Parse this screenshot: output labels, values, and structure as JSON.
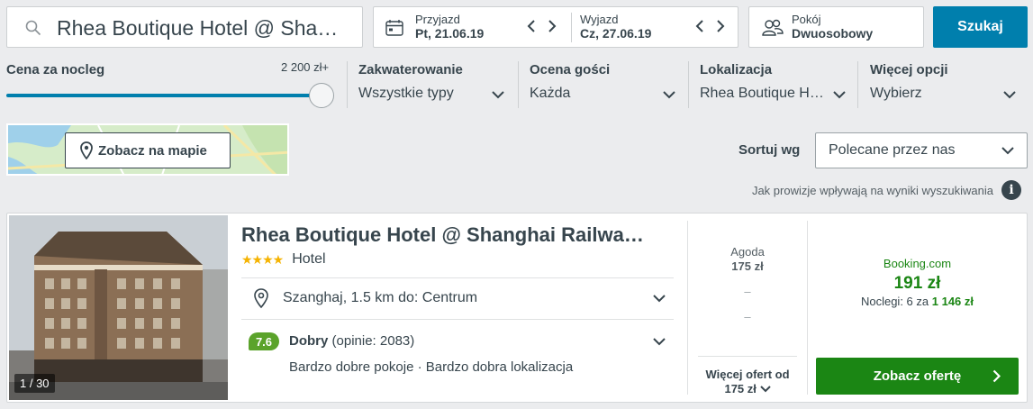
{
  "search": {
    "value": "Rhea Boutique Hotel @ Sha…"
  },
  "dates": {
    "checkin_label": "Przyjazd",
    "checkin_value": "Pt, 21.06.19",
    "checkout_label": "Wyjazd",
    "checkout_value": "Cz, 27.06.19"
  },
  "room": {
    "label": "Pokój",
    "value": "Dwuosobowy"
  },
  "search_button": "Szukaj",
  "filters": {
    "price": {
      "label": "Cena za nocleg",
      "max": "2 200 zł+",
      "slider_fraction": 1.0
    },
    "accommodation": {
      "label": "Zakwaterowanie",
      "value": "Wszystkie typy"
    },
    "rating": {
      "label": "Ocena gości",
      "value": "Każda"
    },
    "location": {
      "label": "Lokalizacja",
      "value": "Rhea Boutique H…"
    },
    "more": {
      "label": "Więcej opcji",
      "value": "Wybierz"
    }
  },
  "map_button": "Zobacz na mapie",
  "sort": {
    "label": "Sortuj wg",
    "value": "Polecane przez nas"
  },
  "commission_note": "Jak prowizje wpływają na wyniki wyszukiwania",
  "hotel": {
    "image_counter": "1 / 30",
    "name": "Rhea Boutique Hotel @ Shanghai Railwa…",
    "stars": 4,
    "type": "Hotel",
    "location": "Szanghaj, 1.5 km do: Centrum",
    "rating_score": "7.6",
    "rating_word": "Dobry",
    "rating_count": "(opinie: 2083)",
    "highlights": "Bardzo dobre pokoje · Bardzo dobra lokalizacja",
    "other_offer": {
      "provider": "Agoda",
      "price": "175 zł",
      "dash1": "–",
      "dash2": "–"
    },
    "more_offers": {
      "label": "Więcej ofert od",
      "price": "175 zł"
    },
    "best_offer": {
      "provider": "Booking.com",
      "price": "191 zł",
      "nights_label": "Noclegi: 6 za",
      "total": "1 146 zł"
    },
    "cta": "Zobacz ofertę"
  },
  "colors": {
    "accent": "#007fad",
    "green": "#1b8614",
    "rating_badge": "#5ba32b",
    "stars": "#f5b301"
  }
}
